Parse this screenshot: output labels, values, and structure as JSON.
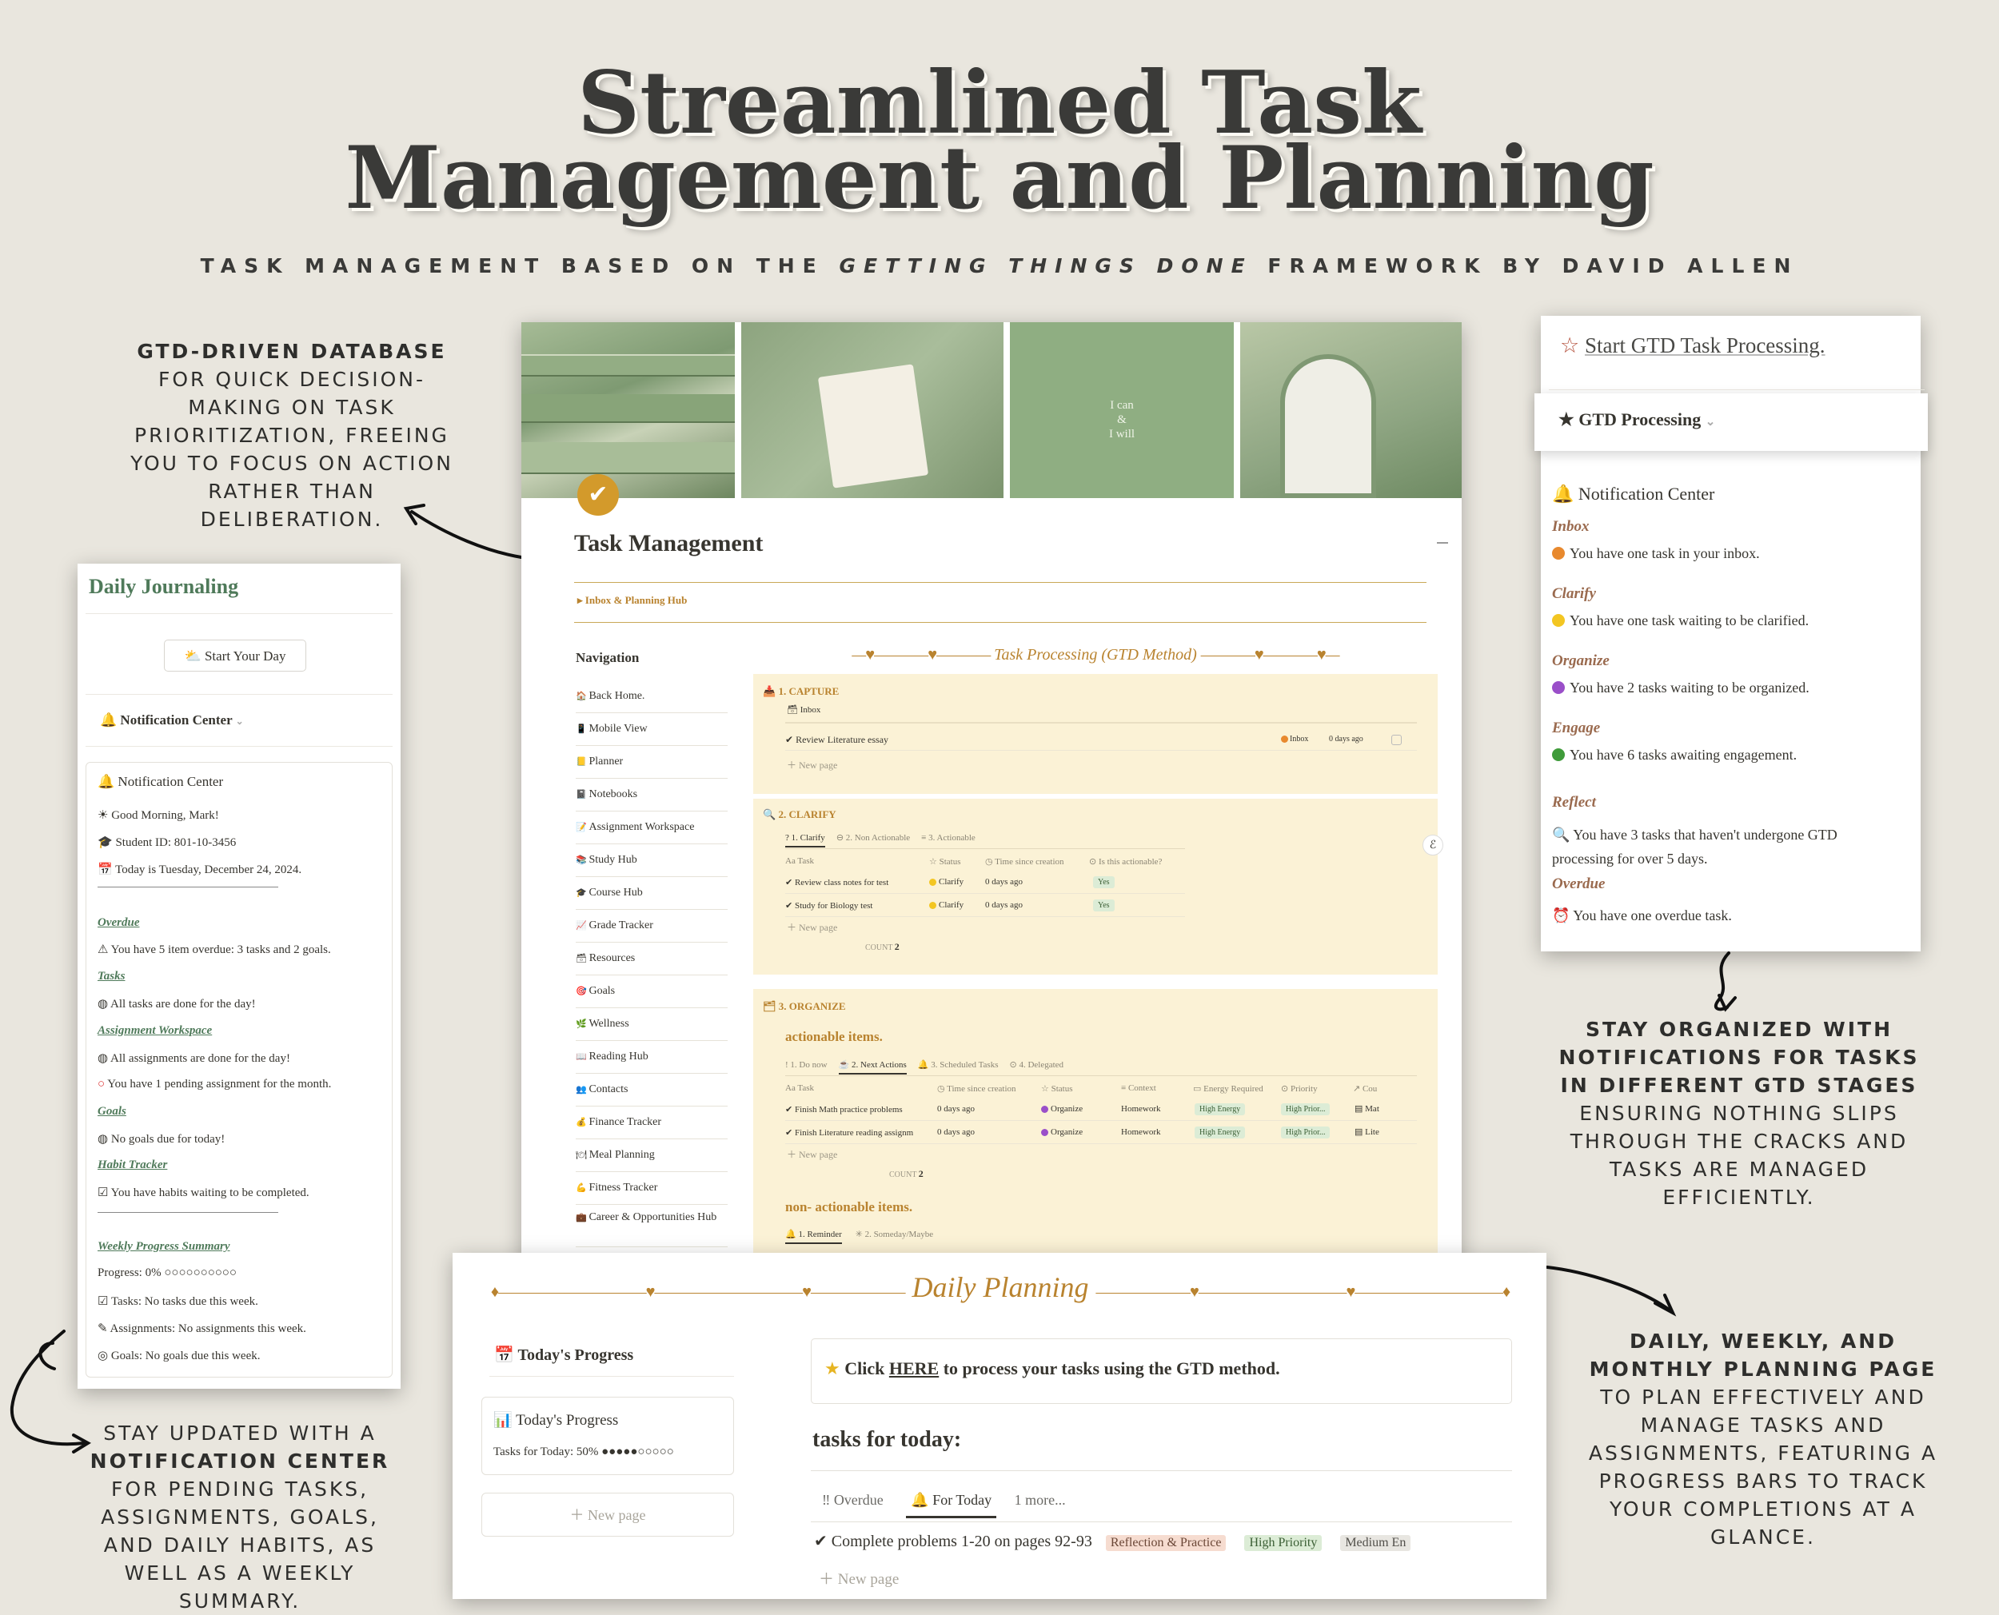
{
  "header": {
    "title_line1": "Streamlined Task",
    "title_line2": "Management and Planning",
    "subtitle_pre": "TASK MANAGEMENT BASED ON THE",
    "subtitle_em": "GETTING THINGS DONE",
    "subtitle_post": "FRAMEWORK BY DAVID ALLEN"
  },
  "captions": {
    "top_left_bold": "GTD-DRIVEN DATABASE",
    "top_left_rest": "FOR QUICK DECISION-MAKING ON TASK PRIORITIZATION, FREEING YOU TO FOCUS ON ACTION RATHER THAN DELIBERATION.",
    "bottom_left_pre": "STAY UPDATED WITH A",
    "bottom_left_bold": "NOTIFICATION CENTER",
    "bottom_left_post": "FOR PENDING TASKS, ASSIGNMENTS, GOALS, AND DAILY HABITS, AS WELL AS A WEEKLY SUMMARY.",
    "mid_right_bold": "STAY ORGANIZED WITH NOTIFICATIONS FOR TASKS IN DIFFERENT GTD STAGES",
    "mid_right_rest": "ENSURING NOTHING SLIPS THROUGH THE CRACKS AND TASKS ARE MANAGED EFFICIENTLY.",
    "bottom_right_bold": "DAILY, WEEKLY, AND MONTHLY PLANNING PAGE",
    "bottom_right_rest": "TO PLAN EFFECTIVELY AND MANAGE TASKS AND ASSIGNMENTS, FEATURING A PROGRESS BARS TO TRACK YOUR COMPLETIONS AT A GLANCE."
  },
  "journal": {
    "title": "Daily Journaling",
    "start_button": "Start Your Day",
    "toggle_label": "Notification Center",
    "card_title": "Notification Center",
    "greeting": "Good Morning, Mark!",
    "student_id": "Student ID: 801-10-3456",
    "today": "Today is Tuesday, December 24, 2024.",
    "overdue_h": "Overdue",
    "overdue_t": "You have 5 item overdue: 3 tasks and 2 goals.",
    "tasks_h": "Tasks",
    "tasks_t": "All tasks are done for the day!",
    "assign_h": "Assignment Workspace",
    "assign_t1": "All assignments are done for the day!",
    "assign_t2": "You have 1 pending assignment for the month.",
    "goals_h": "Goals",
    "goals_t": "No goals due for today!",
    "habit_h": "Habit Tracker",
    "habit_t": "You have habits waiting to be completed.",
    "weekly_h": "Weekly Progress Summary",
    "progress": "Progress: 0% ○○○○○○○○○○",
    "w_tasks": "Tasks: No tasks due this week.",
    "w_assign": "Assignments: No assignments this week.",
    "w_goals": "Goals: No goals due this week."
  },
  "main": {
    "cover_quote_1": "I can",
    "cover_quote_2": "&",
    "cover_quote_3": "I will",
    "title": "Task Management",
    "hub_toggle": "Inbox & Planning Hub",
    "nav_heading": "Navigation",
    "nav": [
      "Back Home.",
      "Mobile View",
      "Planner",
      "Notebooks",
      "Assignment Workspace",
      "Study Hub",
      "Course Hub",
      "Grade Tracker",
      "Resources",
      "Goals",
      "Wellness",
      "Reading Hub",
      "Contacts",
      "Finance Tracker",
      "Meal Planning",
      "Fitness Tracker",
      "Career & Opportunities Hub"
    ],
    "gtd_heading": "Task Processing (GTD Method)",
    "capture": {
      "title": "1. CAPTURE",
      "view": "Inbox",
      "row_task": "Review Literature essay",
      "row_status": "Inbox",
      "row_time": "0 days ago",
      "new_page": "New page"
    },
    "clarify": {
      "title": "2. CLARIFY",
      "tabs": [
        "1. Clarify",
        "2. Non Actionable",
        "3. Actionable"
      ],
      "cols": [
        "Task",
        "Status",
        "Time since creation",
        "Is this actionable?"
      ],
      "rows": [
        {
          "task": "Review class notes for test",
          "status": "Clarify",
          "time": "0 days ago",
          "actionable": "Yes"
        },
        {
          "task": "Study for Biology test",
          "status": "Clarify",
          "time": "0 days ago",
          "actionable": "Yes"
        }
      ],
      "new_page": "New page",
      "count_label": "COUNT",
      "count": "2"
    },
    "organize": {
      "title": "3. ORGANIZE",
      "actionable_h": "actionable items.",
      "tabs": [
        "1. Do now",
        "2. Next Actions",
        "3. Scheduled Tasks",
        "4. Delegated"
      ],
      "cols": [
        "Task",
        "Time since creation",
        "Status",
        "Context",
        "Energy Required",
        "Priority",
        "Cou"
      ],
      "rows": [
        {
          "task": "Finish Math practice problems",
          "time": "0 days ago",
          "status": "Organize",
          "context": "Homework",
          "energy": "High Energy",
          "priority": "High Prior...",
          "course": "Mat"
        },
        {
          "task": "Finish Literature reading assignm",
          "time": "0 days ago",
          "status": "Organize",
          "context": "Homework",
          "energy": "High Energy",
          "priority": "High Prior...",
          "course": "Lite"
        }
      ],
      "new_page": "New page",
      "count_label": "COUNT",
      "count": "2",
      "non_actionable_h": "non- actionable items.",
      "non_tabs": [
        "1. Reminder",
        "2. Someday/Maybe"
      ]
    }
  },
  "gtd_panel": {
    "start_link": "Start GTD Task Processing.",
    "toggle": "GTD Processing",
    "nc_title": "Notification Center",
    "items": [
      {
        "head": "Inbox",
        "text": "You have one task in your inbox.",
        "color": "#e8892e"
      },
      {
        "head": "Clarify",
        "text": "You have one task waiting to be clarified.",
        "color": "#f3c622"
      },
      {
        "head": "Organize",
        "text": "You have 2 tasks waiting to be organized.",
        "color": "#9a4fc9"
      },
      {
        "head": "Engage",
        "text": "You have 6 tasks awaiting engagement.",
        "color": "#3f9b3a"
      }
    ],
    "reflect_h": "Reflect",
    "reflect_t1": "You have 3 tasks that haven't undergone GTD",
    "reflect_t2": "processing for over 5 days.",
    "overdue_h": "Overdue",
    "overdue_t": "You have one overdue task."
  },
  "planning": {
    "title": "Daily Planning",
    "progress_heading": "Today's Progress",
    "progress_card_title": "Today's Progress",
    "progress_text": "Tasks for Today: 50% ●●●●●○○○○○",
    "new_page": "New page",
    "callout_pre": "Click",
    "callout_link": "HERE",
    "callout_post": "to process your tasks using the GTD method.",
    "tasks_heading": "tasks for today:",
    "tabs": [
      "Overdue",
      "For Today",
      "1 more..."
    ],
    "row_task": "Complete problems 1-20 on pages 92-93",
    "row_tag1": "Reflection & Practice",
    "row_tag2": "High Priority",
    "row_tag3": "Medium En",
    "row_new": "New page"
  },
  "colors": {
    "background": "#e9e6de",
    "accent_gold": "#c9a857",
    "sage": "#8fae82",
    "section_brown": "#9a6a4e",
    "yellow_block": "#fbf2d6"
  }
}
